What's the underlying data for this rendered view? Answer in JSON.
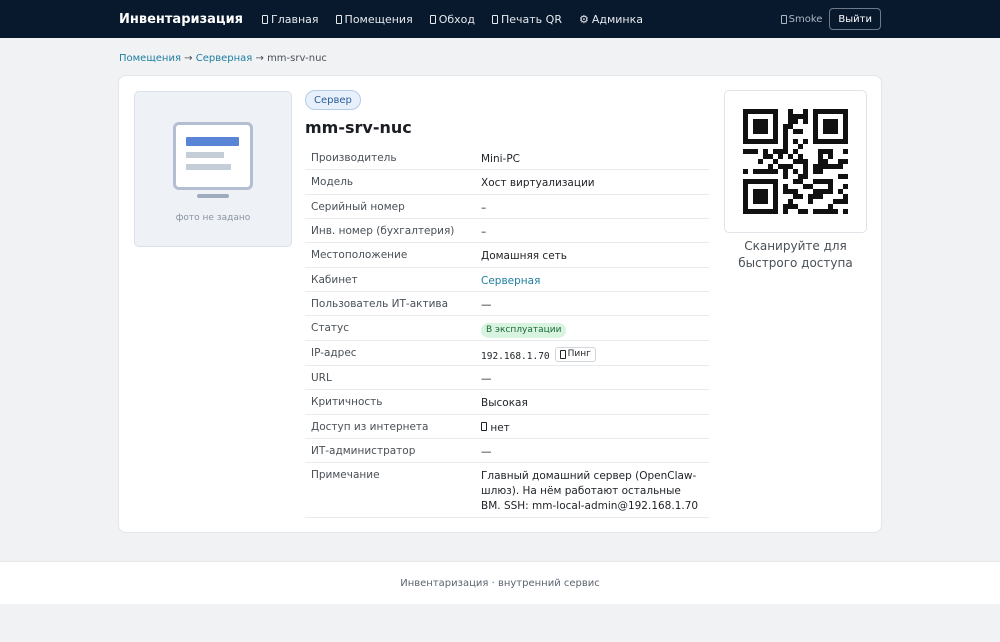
{
  "nav": {
    "brand": "Инвентаризация",
    "links": [
      {
        "label": "Главная"
      },
      {
        "label": "Помещения"
      },
      {
        "label": "Обход"
      },
      {
        "label": "Печать QR"
      },
      {
        "label": "Админка",
        "glyph": "⚙"
      }
    ],
    "user": "Smoke",
    "logout": "Выйти"
  },
  "breadcrumb": {
    "rooms": "Помещения",
    "sep": "→",
    "room": "Серверная",
    "current": "mm-srv-nuc"
  },
  "photo": {
    "caption": "фото не задано",
    "icon": "monitor-placeholder-icon"
  },
  "asset": {
    "type_badge": "Сервер",
    "name": "mm-srv-nuc",
    "fields": [
      {
        "key": "Производитель",
        "value": "Mini-PC"
      },
      {
        "key": "Модель",
        "value": "Хост виртуализации"
      },
      {
        "key": "Серийный номер",
        "value": "–"
      },
      {
        "key": "Инв. номер (бухгалтерия)",
        "value": "–"
      },
      {
        "key": "Местоположение",
        "value": "Домашняя сеть"
      },
      {
        "key": "Кабинет",
        "value": "Серверная"
      },
      {
        "key": "Пользователь ИТ-актива",
        "value": "—"
      },
      {
        "key": "Статус",
        "value": "В эксплуатации"
      },
      {
        "key": "IP-адрес",
        "value": "192.168.1.70",
        "action": "Пинг"
      },
      {
        "key": "URL",
        "value": "—"
      },
      {
        "key": "Критичность",
        "value": "Высокая"
      },
      {
        "key": "Доступ из интернета",
        "value": "нет"
      },
      {
        "key": "ИТ-администратор",
        "value": "—"
      },
      {
        "key": "Примечание",
        "value": "Главный домашний сервер (OpenClaw-шлюз). На нём работают остальные ВМ. SSH: mm-local-admin@192.168.1.70"
      }
    ]
  },
  "qr": {
    "caption": "Сканируйте для быстрого доступа"
  },
  "footer": {
    "text": "Инвентаризация · внутренний сервис"
  },
  "colors": {
    "navbar": "#08192e",
    "accent": "#1f7ea1",
    "status_bg": "#d9f3e1"
  }
}
